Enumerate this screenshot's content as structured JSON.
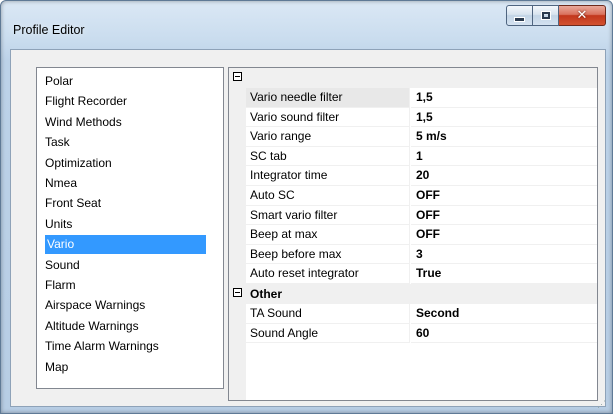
{
  "window": {
    "title": "Profile Editor"
  },
  "caption": {
    "min": "minimize",
    "max": "maximize",
    "close": "close"
  },
  "categories": [
    "Polar",
    "Flight Recorder",
    "Wind Methods",
    "Task",
    "Optimization",
    "Nmea",
    "Front Seat",
    "Units",
    "Vario",
    "Sound",
    "Flarm",
    "Airspace Warnings",
    "Altitude Warnings",
    "Time Alarm Warnings",
    "Map"
  ],
  "selected_category": "Vario",
  "grid": {
    "group1": {
      "label": "",
      "properties": [
        {
          "name": "Vario needle filter",
          "value": "1,5"
        },
        {
          "name": "Vario sound filter",
          "value": "1,5"
        },
        {
          "name": "Vario range",
          "value": "5 m/s"
        },
        {
          "name": "SC tab",
          "value": "1"
        },
        {
          "name": "Integrator time",
          "value": "20"
        },
        {
          "name": "Auto SC",
          "value": "OFF"
        },
        {
          "name": "Smart vario filter",
          "value": "OFF"
        },
        {
          "name": "Beep at max",
          "value": "OFF"
        },
        {
          "name": "Beep before max",
          "value": "3"
        },
        {
          "name": "Auto reset integrator",
          "value": "True"
        }
      ]
    },
    "group2": {
      "label": "Other",
      "properties": [
        {
          "name": "TA Sound",
          "value": "Second"
        },
        {
          "name": "Sound Angle",
          "value": "60"
        }
      ]
    }
  }
}
